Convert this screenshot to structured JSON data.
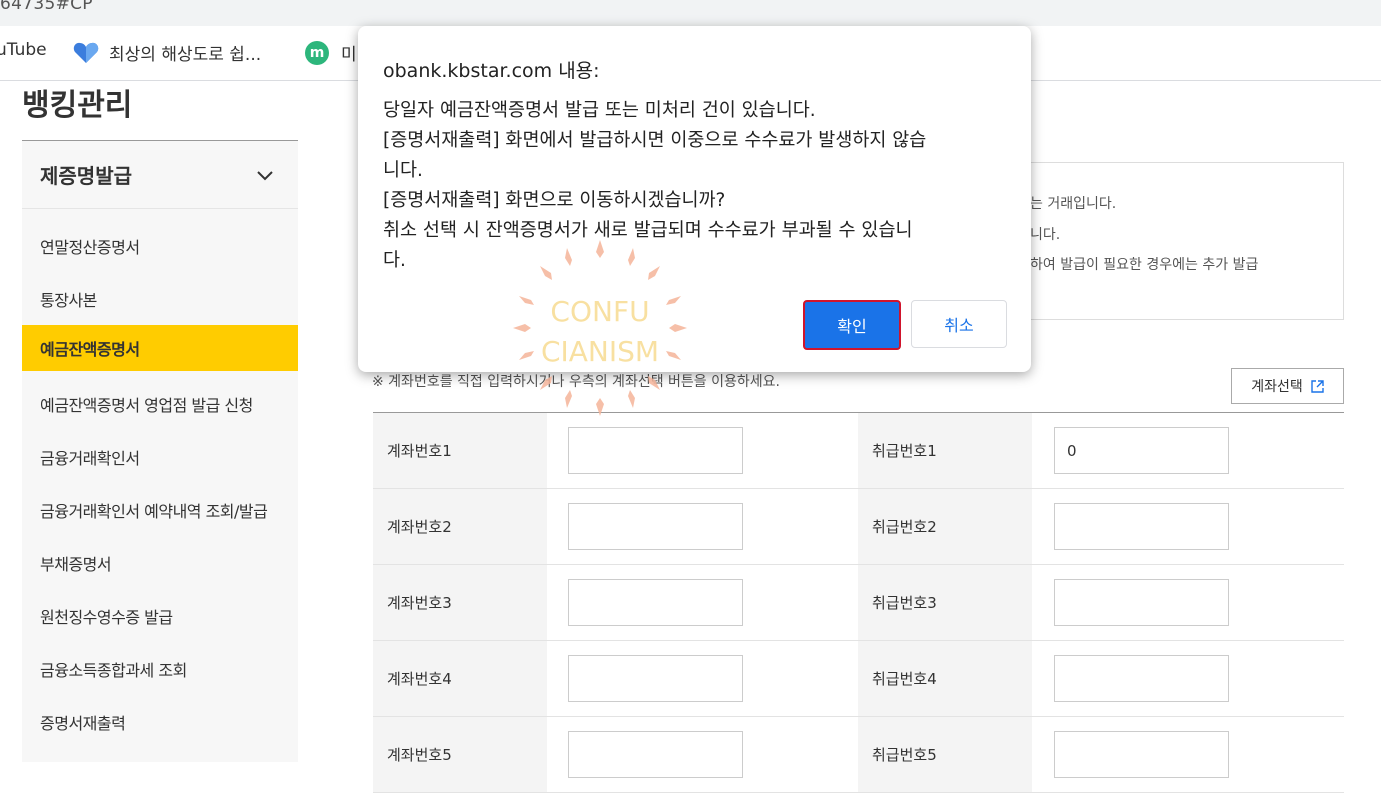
{
  "browser": {
    "url_fragment": "64735#CP",
    "bookmarks": [
      {
        "label": "uTube"
      },
      {
        "label": "최상의 해상도로 쉽..."
      },
      {
        "label": "미",
        "badge": "m"
      }
    ]
  },
  "page": {
    "title": "뱅킹관리",
    "section": "제증명발급",
    "menu": [
      "연말정산증명서",
      "통장사본",
      "예금잔액증명서",
      "예금잔액증명서 영업점 발급 신청",
      "금융거래확인서",
      "금융거래확인서 예약내역 조회/발급",
      "부채증명서",
      "원천징수영수증 발급",
      "금융소득종합과세 조회",
      "증명서재출력"
    ],
    "active_menu": "예금잔액증명서"
  },
  "notice": {
    "lines": [
      "는 거래입니다.",
      "니다.",
      "하여 발급이 필요한 경우에는 추가 발급"
    ]
  },
  "form": {
    "guide": "※ 계좌번호를 직접 입력하시거나 우측의 계좌선택 버튼을 이용하세요.",
    "account_select_label": "계좌선택",
    "rows": [
      {
        "acct_label": "계좌번호1",
        "acct_value": "",
        "handle_label": "취급번호1",
        "handle_value": "0"
      },
      {
        "acct_label": "계좌번호2",
        "acct_value": "",
        "handle_label": "취급번호2",
        "handle_value": ""
      },
      {
        "acct_label": "계좌번호3",
        "acct_value": "",
        "handle_label": "취급번호3",
        "handle_value": ""
      },
      {
        "acct_label": "계좌번호4",
        "acct_value": "",
        "handle_label": "취급번호4",
        "handle_value": ""
      },
      {
        "acct_label": "계좌번호5",
        "acct_value": "",
        "handle_label": "취급번호5",
        "handle_value": ""
      }
    ]
  },
  "dialog": {
    "title": "obank.kbstar.com 내용:",
    "lines": [
      "당일자 예금잔액증명서 발급 또는 미처리 건이 있습니다.",
      "[증명서재출력] 화면에서 발급하시면 이중으로 수수료가 발생하지 않습",
      "니다.",
      "[증명서재출력] 화면으로 이동하시겠습니까?",
      "취소 선택 시 잔액증명서가 새로 발급되며 수수료가 부과될 수 있습니",
      "다."
    ],
    "ok_label": "확인",
    "cancel_label": "취소"
  },
  "watermark": {
    "line1": "CONFU",
    "line2": "CIANISM"
  },
  "colors": {
    "accent": "#ffcc00",
    "button_primary": "#1a73e8",
    "focus_border": "#d0142c"
  }
}
